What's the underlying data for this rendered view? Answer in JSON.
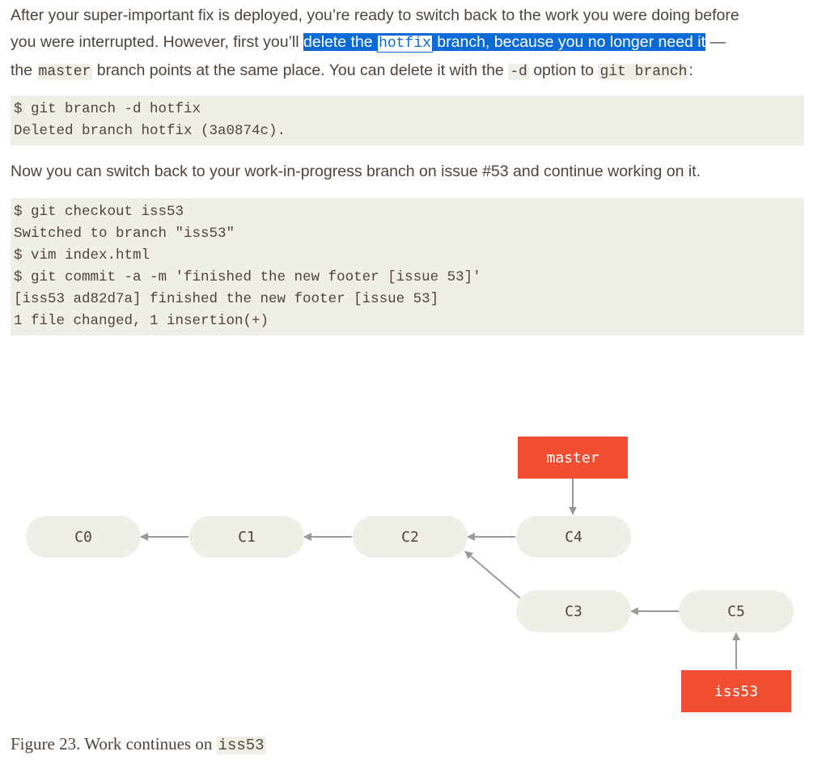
{
  "intro": {
    "line1": "After your super-important fix is deployed, you’re ready to switch back to the work you were doing before",
    "line2_pre": "you were interrupted. However, first you’ll ",
    "line2_sel_a": "delete the ",
    "line2_sel_code": "hotfix",
    "line2_sel_b": " branch, because you no longer need it",
    "line2_post": " —",
    "line3_a": "the ",
    "line3_code1": "master",
    "line3_b": " branch points at the same place. You can delete it with the ",
    "line3_code2": "-d",
    "line3_c": " option to ",
    "line3_code3": "git branch",
    "line3_d": ":"
  },
  "code1": {
    "lines": [
      "$ git branch -d hotfix",
      "Deleted branch hotfix (3a0874c)."
    ]
  },
  "middle": {
    "text": "Now you can switch back to your work-in-progress branch on issue #53 and continue working on it."
  },
  "code2": {
    "lines": [
      "$ git checkout iss53",
      "Switched to branch \"iss53\"",
      "$ vim index.html",
      "$ git commit -a -m 'finished the new footer [issue 53]'",
      "[iss53 ad82d7a] finished the new footer [issue 53]",
      "1 file changed, 1 insertion(+)"
    ]
  },
  "diagram": {
    "commits": [
      "C0",
      "C1",
      "C2",
      "C4",
      "C3",
      "C5"
    ],
    "branches": {
      "master": "master",
      "iss53": "iss53"
    },
    "colors": {
      "commit_fill": "#f0efe7",
      "branch_fill": "#f14e32",
      "branch_text": "#ffffff",
      "arrow": "#9a9a9a"
    }
  },
  "caption": {
    "prefix": "Figure 23. Work continues on ",
    "code": "iss53"
  }
}
